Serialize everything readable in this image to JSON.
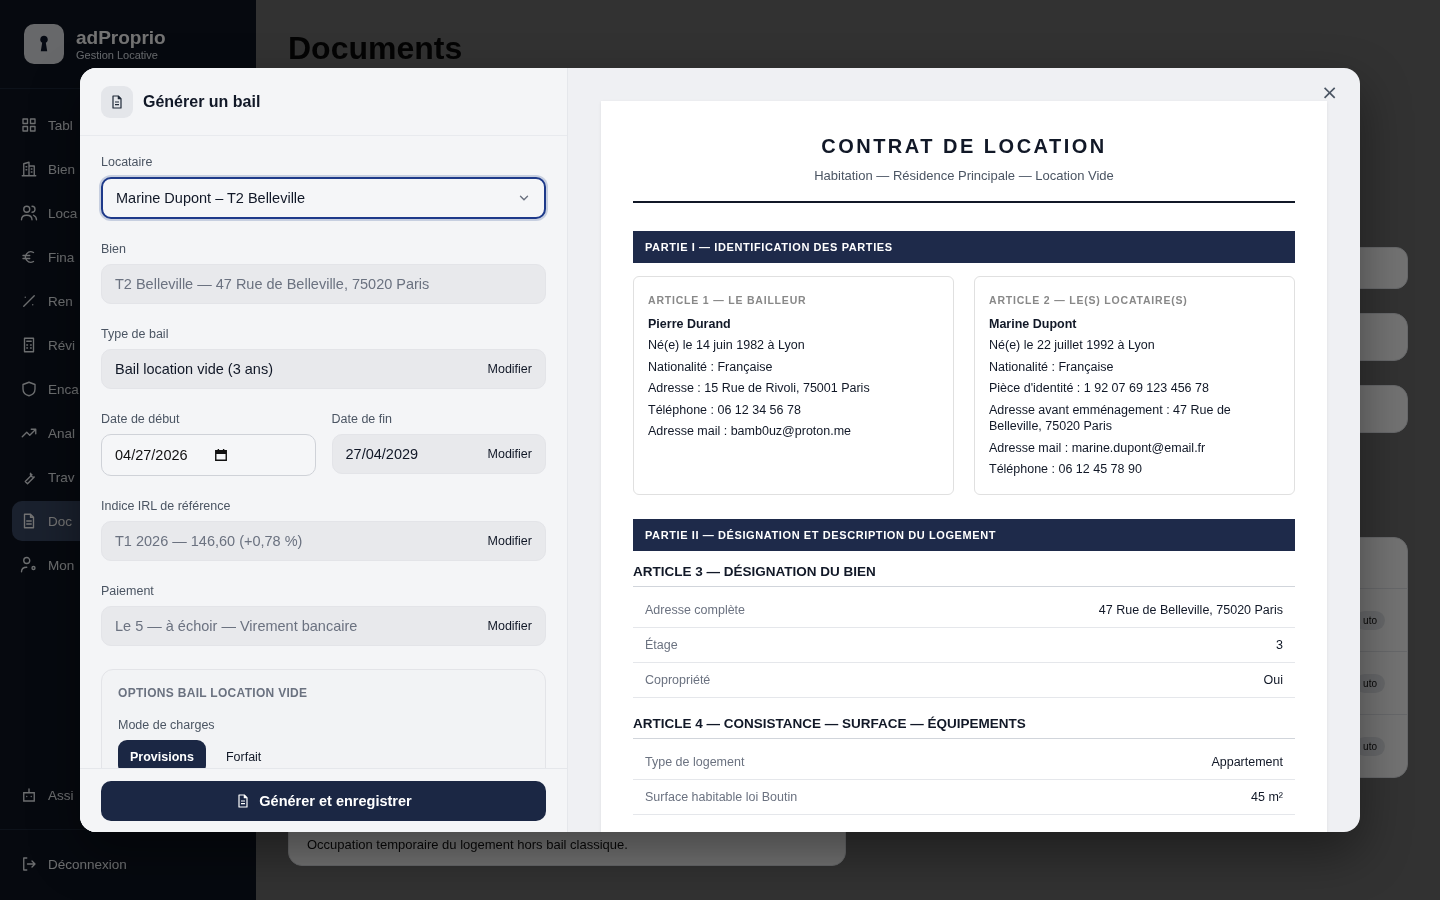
{
  "app": {
    "logo": {
      "name": "adProprio",
      "tagline": "Gestion Locative"
    },
    "sidebar": {
      "items": [
        {
          "label": "Tabl",
          "selected": false
        },
        {
          "label": "Bien",
          "selected": false
        },
        {
          "label": "Loca",
          "selected": false
        },
        {
          "label": "Fina",
          "selected": false
        },
        {
          "label": "Ren",
          "selected": false
        },
        {
          "label": "Révi",
          "selected": false
        },
        {
          "label": "Enca",
          "selected": false
        },
        {
          "label": "Anal",
          "selected": false
        },
        {
          "label": "Trav",
          "selected": false
        },
        {
          "label": "Doc",
          "selected": true
        },
        {
          "label": "Mon",
          "selected": false
        }
      ],
      "assistant": "Assi",
      "logout": "Déconnexion"
    },
    "page_title": "Documents",
    "card_text": "Occupation temporaire du logement hors bail classique.",
    "badges": [
      "uto",
      "uto",
      "uto"
    ]
  },
  "dialog": {
    "title": "Générer un bail",
    "fields": [
      {
        "kind": "select",
        "label": "Locataire",
        "value": "Marine Dupont – T2 Belleville",
        "focused": true
      },
      {
        "kind": "readonly",
        "label": "Bien",
        "value": "T2 Belleville — 47 Rue de Belleville, 75020 Paris",
        "muted": true
      },
      {
        "kind": "locked",
        "label": "Type de bail",
        "value": "Bail location vide (3 ans)",
        "muted": false,
        "action": "Modifier"
      },
      {
        "kind": "pair",
        "items": [
          {
            "kind": "date",
            "label": "Date de début",
            "value": "04/27/2026"
          },
          {
            "kind": "locked",
            "label": "Date de fin",
            "value": "27/04/2029",
            "muted": false,
            "action": "Modifier"
          }
        ]
      },
      {
        "kind": "locked",
        "label": "Indice IRL de référence",
        "value": "T1 2026 — 146,60 (+0,78 %)",
        "muted": true,
        "action": "Modifier"
      },
      {
        "kind": "locked",
        "label": "Paiement",
        "value": "Le 5 — à échoir — Virement bancaire",
        "muted": true,
        "action": "Modifier"
      }
    ],
    "options": {
      "title": "OPTIONS BAIL LOCATION VIDE",
      "label": "Mode de charges",
      "choices": [
        {
          "label": "Provisions",
          "selected": true
        },
        {
          "label": "Forfait",
          "selected": false
        }
      ]
    },
    "submit": "Générer et enregistrer",
    "close": "×",
    "document": {
      "title": "CONTRAT DE LOCATION",
      "subtitle": "Habitation — Résidence Principale — Location Vide",
      "sections": [
        {
          "kind": "parties",
          "heading": "PARTIE I — IDENTIFICATION DES PARTIES",
          "parties": [
            {
              "heading": "ARTICLE 1 — LE BAILLEUR",
              "name": "Pierre Durand",
              "lines": [
                "Né(e) le 14 juin 1982 à Lyon",
                "Nationalité : Française",
                "Adresse : 15 Rue de Rivoli, 75001 Paris",
                "Téléphone : 06 12 34 56 78",
                "Adresse mail : bamb0uz@proton.me"
              ]
            },
            {
              "heading": "ARTICLE 2 — LE(S) LOCATAIRE(S)",
              "name": "Marine Dupont",
              "lines": [
                "Né(e) le 22 juillet 1992 à Lyon",
                "Nationalité : Française",
                "Pièce d'identité : 1 92 07 69 123 456 78",
                "Adresse avant emménagement : 47 Rue de Belleville, 75020 Paris",
                "Adresse mail : marine.dupont@email.fr",
                "Téléphone : 06 12 45 78 90"
              ]
            }
          ]
        },
        {
          "kind": "articles",
          "heading": "PARTIE II — DÉSIGNATION ET DESCRIPTION DU LOGEMENT",
          "articles": [
            {
              "title": "ARTICLE 3 — DÉSIGNATION DU BIEN",
              "rows": [
                {
                  "label": "Adresse complète",
                  "value": "47 Rue de Belleville, 75020 Paris"
                },
                {
                  "label": "Étage",
                  "value": "3"
                },
                {
                  "label": "Copropriété",
                  "value": "Oui"
                }
              ]
            },
            {
              "title": "ARTICLE 4 — CONSISTANCE — SURFACE — ÉQUIPEMENTS",
              "rows": [
                {
                  "label": "Type de logement",
                  "value": "Appartement"
                },
                {
                  "label": "Surface habitable loi Boutin",
                  "value": "45 m²"
                }
              ]
            }
          ]
        }
      ]
    }
  }
}
